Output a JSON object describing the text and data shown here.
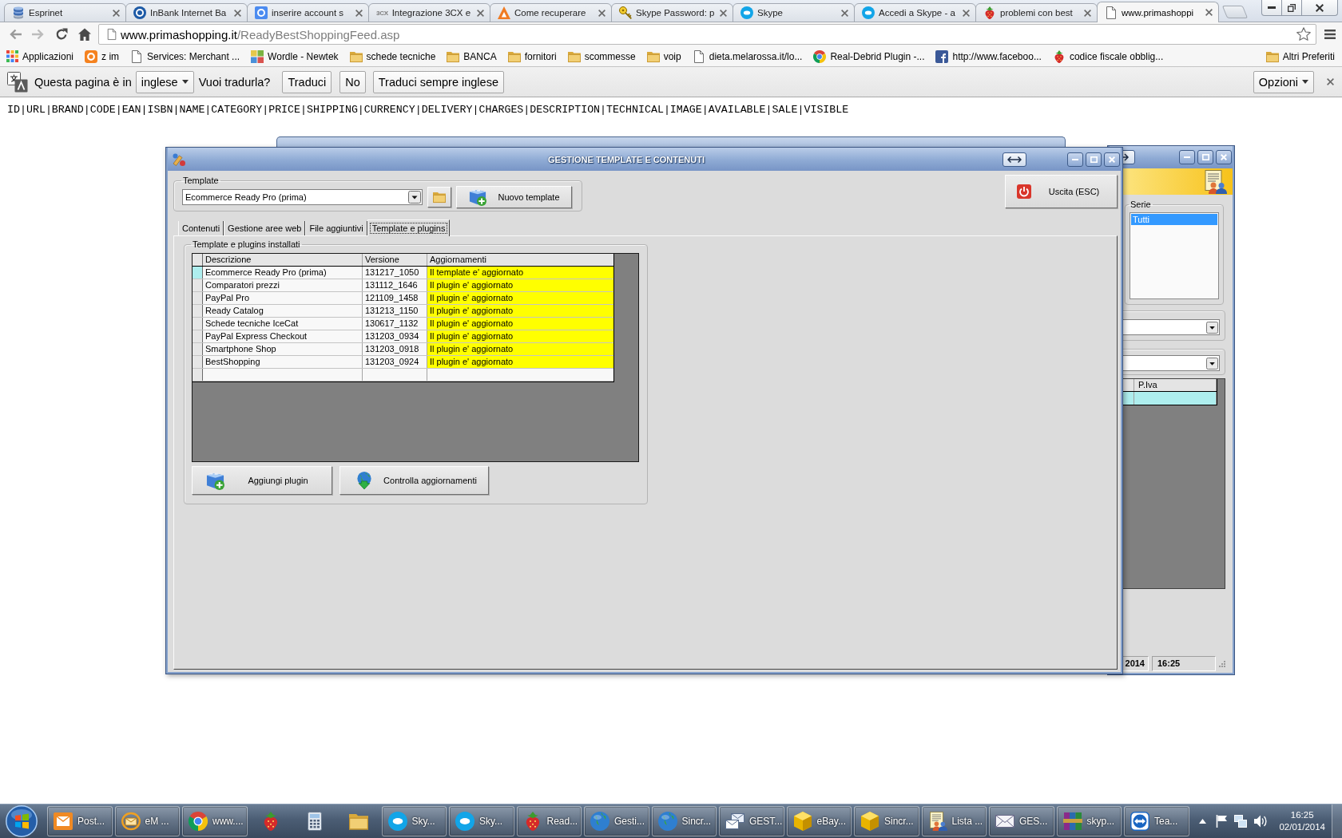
{
  "browser": {
    "tabs": [
      {
        "kind": "stack",
        "title": "Esprinet",
        "selected": false
      },
      {
        "kind": "circle",
        "title": "InBank Internet Ba",
        "selected": false
      },
      {
        "kind": "square",
        "title": "inserire account s",
        "selected": false
      },
      {
        "kind": "logo-text",
        "logo": "3CX",
        "title": "Integrazione 3CX e",
        "selected": false
      },
      {
        "kind": "triangle",
        "title": "Come recuperare",
        "selected": false
      },
      {
        "kind": "key",
        "title": "Skype Password: p",
        "selected": false
      },
      {
        "kind": "cloud",
        "title": "Skype",
        "selected": false
      },
      {
        "kind": "cloud",
        "title": "Accedi a Skype - a",
        "selected": false
      },
      {
        "kind": "strawberry",
        "title": "problemi con best",
        "selected": false
      },
      {
        "kind": "page",
        "title": "www.primashoppi",
        "selected": true
      }
    ],
    "address": {
      "host": "www.primashopping.it",
      "path": "/ReadyBestShoppingFeed.asp"
    },
    "bookmarks": [
      {
        "kind": "grid",
        "label": "Applicazioni"
      },
      {
        "kind": "badge",
        "label": "z im"
      },
      {
        "kind": "page",
        "label": "Services: Merchant ..."
      },
      {
        "kind": "tiles",
        "label": "Wordle - Newtek"
      },
      {
        "kind": "folder",
        "label": "schede tecniche"
      },
      {
        "kind": "folder",
        "label": "BANCA"
      },
      {
        "kind": "folder",
        "label": "fornitori"
      },
      {
        "kind": "folder",
        "label": "scommesse"
      },
      {
        "kind": "folder",
        "label": "voip"
      },
      {
        "kind": "page",
        "label": "dieta.melarossa.it/lo..."
      },
      {
        "kind": "ring",
        "label": "Real-Debrid Plugin -..."
      },
      {
        "kind": "fsquare",
        "label": "http://www.faceboo..."
      },
      {
        "kind": "strawberry",
        "label": "codice fiscale obblig..."
      }
    ],
    "other_bookmarks": {
      "kind": "folder",
      "label": "Altri Preferiti"
    },
    "translate_bar": {
      "prompt": "Questa pagina è in",
      "language": "inglese",
      "question": "Vuoi tradurla?",
      "buttons": [
        "Traduci",
        "No",
        "Traduci sempre inglese"
      ],
      "options": "Opzioni"
    }
  },
  "page": {
    "text": "ID|URL|BRAND|CODE|EAN|ISBN|NAME|CATEGORY|PRICE|SHIPPING|CURRENCY|DELIVERY|CHARGES|DESCRIPTION|TECHNICAL|IMAGE|AVAILABLE|SALE|VISIBLE"
  },
  "dialog": {
    "title": "GESTIONE TEMPLATE E CONTENUTI",
    "template_group": {
      "label": "Template",
      "value": "Ecommerce Ready Pro (prima)",
      "new_button": "Nuovo template"
    },
    "exit_button": "Uscita (ESC)",
    "tabs": [
      {
        "label": "Contenuti",
        "selected": false
      },
      {
        "label": "Gestione aree web",
        "selected": false
      },
      {
        "label": "File aggiuntivi",
        "selected": false
      },
      {
        "label": "Template e plugins",
        "selected": true
      }
    ],
    "plugins_group": {
      "label": "Template e plugins installati",
      "table": {
        "columns": [
          "Descrizione",
          "Versione",
          "Aggiornamenti"
        ],
        "rows": [
          {
            "cells": [
              "Ecommerce Ready Pro (prima)",
              "131217_1050",
              "Il template e' aggiornato"
            ],
            "selected": true
          },
          {
            "cells": [
              "Comparatori prezzi",
              "131112_1646",
              "Il plugin e' aggiornato"
            ],
            "selected": false
          },
          {
            "cells": [
              "PayPal Pro",
              "121109_1458",
              "Il plugin e' aggiornato"
            ],
            "selected": false
          },
          {
            "cells": [
              "Ready Catalog",
              "131213_1150",
              "Il plugin e' aggiornato"
            ],
            "selected": false
          },
          {
            "cells": [
              "Schede tecniche IceCat",
              "130617_1132",
              "Il plugin e' aggiornato"
            ],
            "selected": false
          },
          {
            "cells": [
              "PayPal Express Checkout",
              "131203_0934",
              "Il plugin e' aggiornato"
            ],
            "selected": false
          },
          {
            "cells": [
              "Smartphone Shop",
              "131203_0918",
              "Il plugin e' aggiornato"
            ],
            "selected": false
          },
          {
            "cells": [
              "BestShopping",
              "131203_0924",
              "Il plugin e' aggiornato"
            ],
            "selected": false
          }
        ]
      },
      "buttons": [
        {
          "kind": "add",
          "label": "Aggiungi plugin"
        },
        {
          "kind": "update",
          "label": "Controlla aggiornamenti"
        }
      ]
    }
  },
  "side_window": {
    "series_group": {
      "label": "Serie",
      "items": [
        {
          "label": "Tutti",
          "selected": true
        }
      ]
    },
    "table": {
      "columns": [
        "P.Iva"
      ],
      "rows": [
        {
          "selected": true
        }
      ]
    },
    "status_bar": [
      "2014",
      "16:25"
    ]
  },
  "taskbar": {
    "items": [
      {
        "kind": "mail",
        "label": "Post..."
      },
      {
        "kind": "envring",
        "label": "eM ..."
      },
      {
        "kind": "ring",
        "label": "www...."
      },
      {
        "kind": "strawberry"
      },
      {
        "kind": "calculator"
      },
      {
        "kind": "folder"
      },
      {
        "kind": "cloud",
        "label": "Sky..."
      },
      {
        "kind": "cloud",
        "label": "Sky..."
      },
      {
        "kind": "strawberry",
        "label": "Read..."
      },
      {
        "kind": "globe",
        "label": "Gesti..."
      },
      {
        "kind": "globe",
        "label": "Sincr..."
      },
      {
        "kind": "envstack",
        "label": "GEST..."
      },
      {
        "kind": "cube",
        "label": "eBay..."
      },
      {
        "kind": "cube",
        "label": "Sincr..."
      },
      {
        "kind": "document",
        "label": "Lista ..."
      },
      {
        "kind": "envelope",
        "label": "GES..."
      },
      {
        "kind": "books",
        "label": "skyp..."
      },
      {
        "kind": "arrows",
        "label": "Tea..."
      }
    ],
    "clock": {
      "time": "16:25",
      "date": "02/01/2014"
    }
  }
}
